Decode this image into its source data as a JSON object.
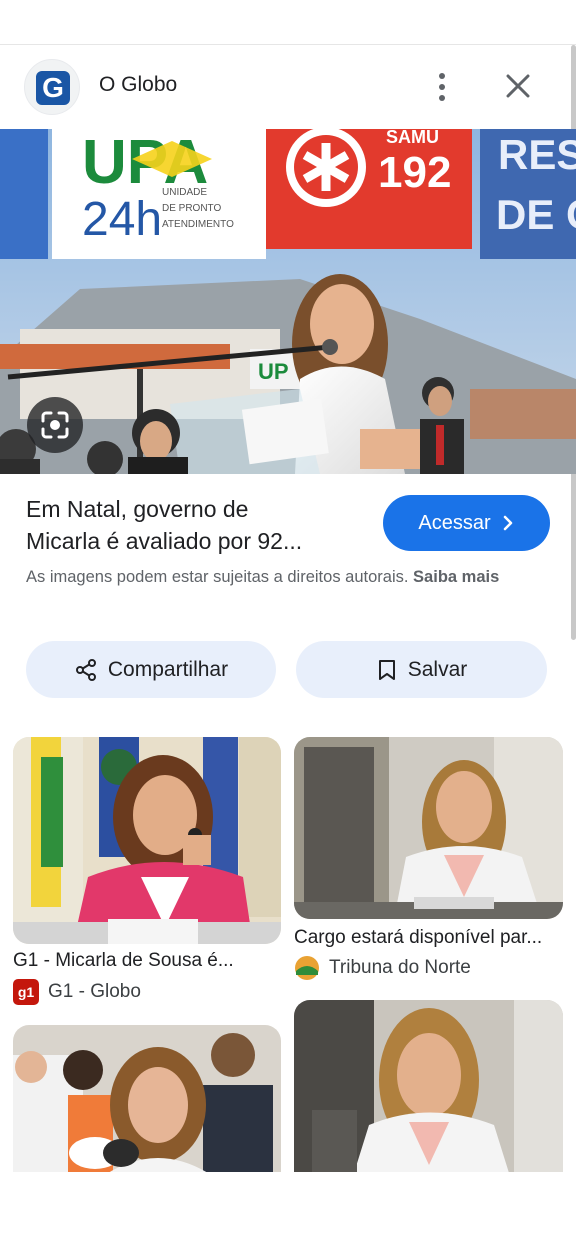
{
  "header": {
    "logo_letter": "G",
    "site_name": "O Globo"
  },
  "hero": {
    "sign_upa": "UPA",
    "sign_24h": "24h",
    "sign_unidade": "UNIDADE",
    "sign_de_pronto": "DE PRONTO",
    "sign_atendimento": "ATENDIMENTO",
    "sign_samu": "SAMU",
    "sign_192": "192",
    "sign_res": "RES",
    "sign_deq": "DE Q",
    "sign_up": "UP"
  },
  "result": {
    "title_line1": "Em Natal, governo de",
    "title_line2": "Micarla é avaliado por 92...",
    "visit_label": "Acessar",
    "copyright_text": "As imagens podem estar sujeitas a direitos autorais.",
    "learn_more": "Saiba mais"
  },
  "actions": {
    "share_label": "Compartilhar",
    "save_label": "Salvar"
  },
  "related": [
    {
      "caption": "G1 - Micarla de Sousa é...",
      "source": "G1 - Globo",
      "source_logo": "g1"
    },
    {
      "caption": "Cargo estará disponível par...",
      "source": "Tribuna do Norte",
      "source_logo": "tribuna-icon"
    },
    {
      "caption": "",
      "source": ""
    },
    {
      "caption": "",
      "source": ""
    }
  ],
  "colors": {
    "accent": "#1a73e8",
    "pill_bg": "#e8effb",
    "text": "#202124",
    "muted": "#5f6368"
  }
}
